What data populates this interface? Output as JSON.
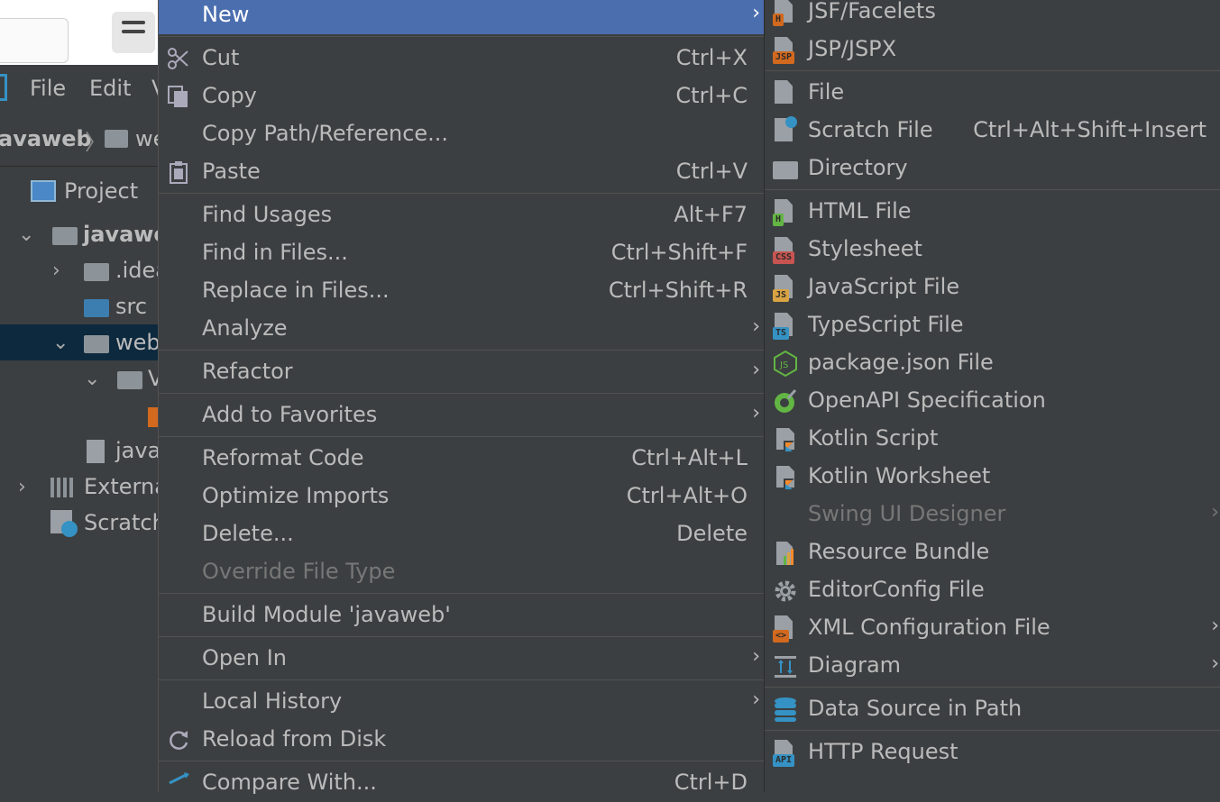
{
  "menubar": {
    "file": "File",
    "edit": "Edit",
    "view_partial": "V"
  },
  "breadcrumb": {
    "project": "avaweb",
    "module": "we"
  },
  "project_panel": {
    "title": "Project"
  },
  "tree": [
    {
      "label": "javawe",
      "bold": true
    },
    {
      "label": ".idea"
    },
    {
      "label": "src"
    },
    {
      "label": "web"
    },
    {
      "label": "V"
    },
    {
      "label": ""
    },
    {
      "label": "java"
    },
    {
      "label": "Externa"
    },
    {
      "label": "Scratch"
    }
  ],
  "context_menu": {
    "items": [
      {
        "label": "New",
        "shortcut": "",
        "submenu": true,
        "selected": true
      },
      {
        "label": "Cut",
        "shortcut": "Ctrl+X",
        "icon": "scissors-icon"
      },
      {
        "label": "Copy",
        "shortcut": "Ctrl+C",
        "icon": "copy-icon"
      },
      {
        "label": "Copy Path/Reference...",
        "shortcut": ""
      },
      {
        "label": "Paste",
        "shortcut": "Ctrl+V",
        "icon": "clipboard-icon"
      },
      {
        "label": "Find Usages",
        "shortcut": "Alt+F7"
      },
      {
        "label": "Find in Files...",
        "shortcut": "Ctrl+Shift+F"
      },
      {
        "label": "Replace in Files...",
        "shortcut": "Ctrl+Shift+R"
      },
      {
        "label": "Analyze",
        "shortcut": "",
        "submenu": true
      },
      {
        "label": "Refactor",
        "shortcut": "",
        "submenu": true
      },
      {
        "label": "Add to Favorites",
        "shortcut": "",
        "submenu": true
      },
      {
        "label": "Reformat Code",
        "shortcut": "Ctrl+Alt+L"
      },
      {
        "label": "Optimize Imports",
        "shortcut": "Ctrl+Alt+O"
      },
      {
        "label": "Delete...",
        "shortcut": "Delete"
      },
      {
        "label": "Override File Type",
        "shortcut": "",
        "disabled": true
      },
      {
        "label": "Build Module 'javaweb'",
        "shortcut": ""
      },
      {
        "label": "Open In",
        "shortcut": "",
        "submenu": true
      },
      {
        "label": "Local History",
        "shortcut": "",
        "submenu": true
      },
      {
        "label": "Reload from Disk",
        "shortcut": "",
        "icon": "reload-icon"
      },
      {
        "label": "Compare With...",
        "shortcut": "Ctrl+D",
        "icon": "compare-icon"
      }
    ]
  },
  "new_submenu": {
    "items": [
      {
        "label": "JSF/Facelets",
        "badge": "H",
        "badge_color": "#d2691e"
      },
      {
        "label": "JSP/JSPX",
        "badge": "JSP",
        "badge_color": "#d2691e"
      },
      {
        "label": "File",
        "badge": "",
        "badge_color": ""
      },
      {
        "label": "Scratch File",
        "shortcut": "Ctrl+Alt+Shift+Insert",
        "badge": "",
        "badge_color": "#3592c4"
      },
      {
        "label": "Directory",
        "icon": "folder-icon"
      },
      {
        "label": "HTML File",
        "badge": "H",
        "badge_color": "#62b543"
      },
      {
        "label": "Stylesheet",
        "badge": "CSS",
        "badge_color": "#c75450"
      },
      {
        "label": "JavaScript File",
        "badge": "JS",
        "badge_color": "#d9a343"
      },
      {
        "label": "TypeScript File",
        "badge": "TS",
        "badge_color": "#3592c4"
      },
      {
        "label": "package.json File",
        "icon": "nodejs-icon"
      },
      {
        "label": "OpenAPI Specification",
        "icon": "openapi-icon"
      },
      {
        "label": "Kotlin Script",
        "icon": "kotlin-icon"
      },
      {
        "label": "Kotlin Worksheet",
        "icon": "kotlin-icon"
      },
      {
        "label": "Swing UI Designer",
        "disabled": true,
        "submenu": true
      },
      {
        "label": "Resource Bundle",
        "icon": "bundle-icon"
      },
      {
        "label": "EditorConfig File",
        "icon": "gear-icon"
      },
      {
        "label": "XML Configuration File",
        "badge": "<>",
        "badge_color": "#d2691e",
        "submenu": true
      },
      {
        "label": "Diagram",
        "icon": "diagram-icon",
        "submenu": true
      },
      {
        "label": "Data Source in Path",
        "icon": "database-icon"
      },
      {
        "label": "HTTP Request",
        "badge": "API",
        "badge_color": "#3592c4"
      }
    ]
  }
}
